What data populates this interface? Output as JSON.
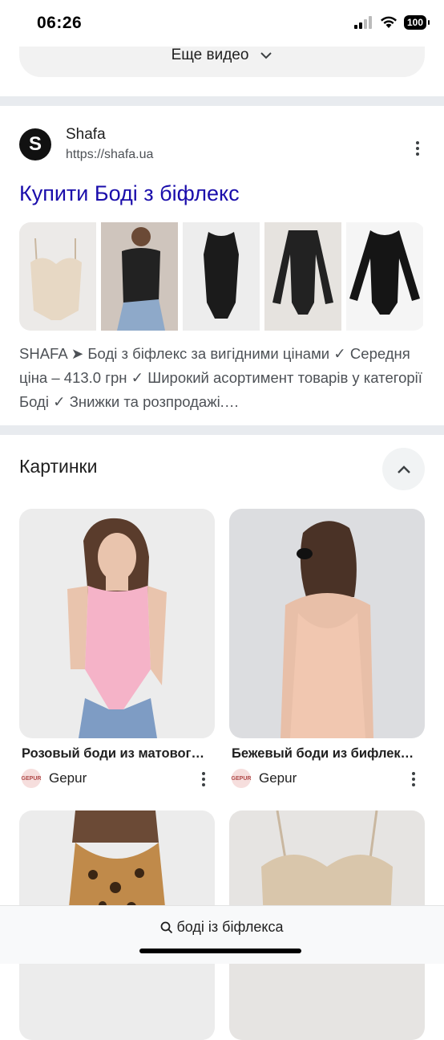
{
  "status_bar": {
    "time": "06:26",
    "battery": "100",
    "signal_icon": "cellular-signal-icon",
    "wifi_icon": "wifi-icon"
  },
  "videos": {
    "more_label": "Еще видео",
    "chevron_icon": "chevron-down-icon"
  },
  "result": {
    "favicon_letter": "S",
    "site_name": "Shafa",
    "url": "https://shafa.ua",
    "title": "Купити Боді з біфлекс",
    "snippet": "SHAFA ➤ Боді з біфлекс за вигідними цінами ✓ Середня ціна – 413.0 грн ✓ Широкий асортимент товарів у категорії Боді ✓ Знижки та розпродажі.…"
  },
  "images_section": {
    "title": "Картинки",
    "collapse_icon": "chevron-up-icon",
    "cards": [
      {
        "title": "Розовый боди из матовог…",
        "source": "Gepur",
        "favicon": "GEPUR"
      },
      {
        "title": "Бежевый боди из бифлек…",
        "source": "Gepur",
        "favicon": "GEPUR"
      }
    ]
  },
  "bottom_bar": {
    "query": "боді із біфлекса",
    "search_icon": "search-icon"
  },
  "colors": {
    "link": "#1a0dab",
    "divider": "#e8ebef",
    "snippet": "#4d5156"
  }
}
